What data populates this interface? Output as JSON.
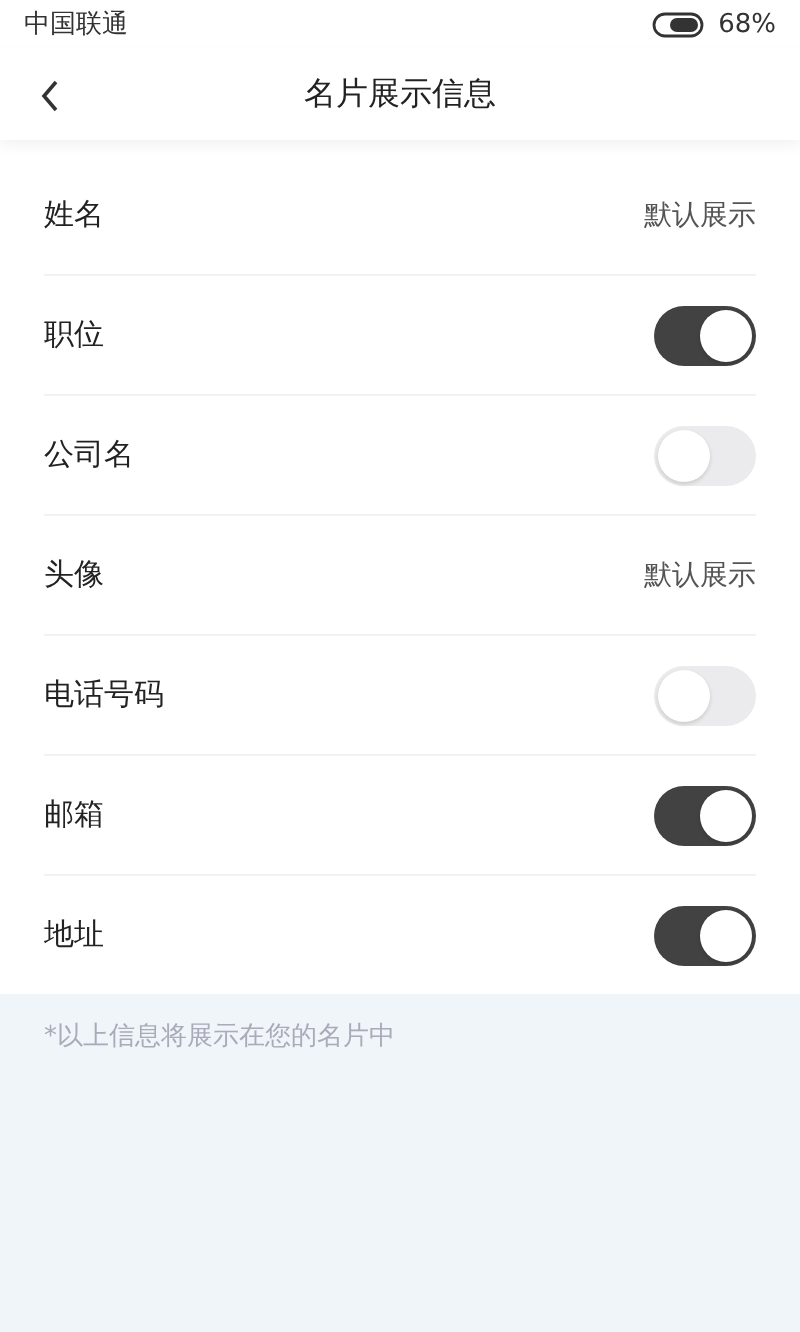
{
  "status_bar": {
    "carrier": "中国联通",
    "battery": "68%"
  },
  "nav": {
    "title": "名片展示信息"
  },
  "rows": [
    {
      "kind": "text",
      "label": "姓名",
      "value": "默认展示"
    },
    {
      "kind": "toggle",
      "label": "职位",
      "on": true
    },
    {
      "kind": "toggle",
      "label": "公司名",
      "on": false
    },
    {
      "kind": "text",
      "label": "头像",
      "value": "默认展示"
    },
    {
      "kind": "toggle",
      "label": "电话号码",
      "on": false
    },
    {
      "kind": "toggle",
      "label": "邮箱",
      "on": true
    },
    {
      "kind": "toggle",
      "label": "地址",
      "on": true
    }
  ],
  "note": "*以上信息将展示在您的名片中"
}
